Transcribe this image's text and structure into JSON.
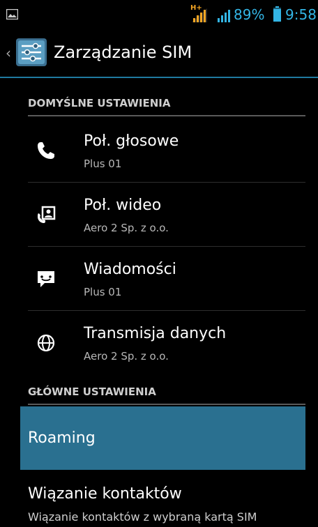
{
  "status_bar": {
    "network_type": "H+",
    "battery_percent": "89%",
    "time": "9:58",
    "icons": [
      "gallery-icon",
      "signal-icon",
      "battery-icon"
    ],
    "accent_color": "#33b5e5"
  },
  "action_bar": {
    "title": "Zarządzanie SIM",
    "icon": "sim-settings-icon"
  },
  "sections": {
    "default_settings": {
      "header": "DOMYŚLNE USTAWIENIA",
      "items": [
        {
          "title": "Poł. głosowe",
          "subtitle": "Plus 01",
          "icon": "phone-icon"
        },
        {
          "title": "Poł. wideo",
          "subtitle": "Aero 2 Sp. z o.o.",
          "icon": "video-call-icon"
        },
        {
          "title": "Wiadomości",
          "subtitle": "Plus 01",
          "icon": "message-icon"
        },
        {
          "title": "Transmisja danych",
          "subtitle": "Aero 2 Sp. z o.o.",
          "icon": "globe-icon"
        }
      ]
    },
    "main_settings": {
      "header": "GŁÓWNE USTAWIENIA",
      "roaming": {
        "title": "Roaming"
      },
      "contact_binding": {
        "title": "Wiązanie kontaktów",
        "subtitle": "Wiązanie kontaktów z wybraną kartą SIM"
      }
    }
  },
  "colors": {
    "highlight": "#2a7090",
    "divider_accent": "#1f7aa0"
  }
}
